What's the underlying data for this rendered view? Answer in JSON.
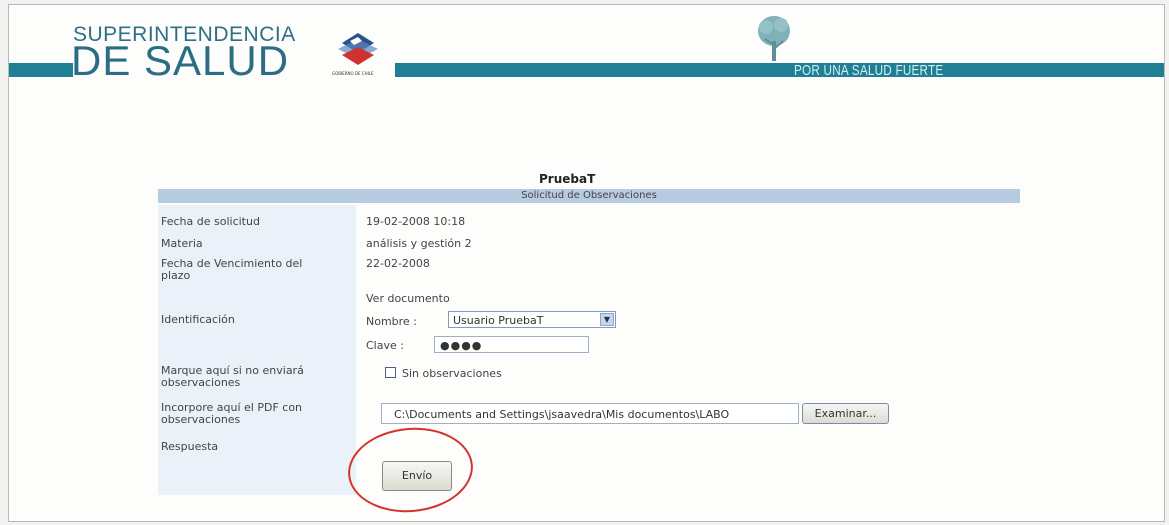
{
  "header": {
    "logo_line1": "SUPERINTENDENCIA",
    "logo_line2": "DE SALUD",
    "logo_small_text": "GOBIERNO DE CHILE",
    "slogan": "POR UNA SALUD FUERTE",
    "band_color": "#1e7f95"
  },
  "form": {
    "title": "PruebaT",
    "subtitle": "Solicitud de Observaciones",
    "labels": {
      "fecha_solicitud": "Fecha de solicitud",
      "materia": "Materia",
      "fecha_vencimiento_1": "Fecha de Vencimiento del",
      "fecha_vencimiento_2": "plazo",
      "identificacion": "Identificación",
      "sin_obs_1": "Marque aquí si no enviará",
      "sin_obs_2": "observaciones",
      "pdf_1": "Incorpore aquí el PDF con",
      "pdf_2": "observaciones",
      "respuesta": "Respuesta"
    },
    "values": {
      "fecha_solicitud": "19-02-2008 10:18",
      "materia": "análisis y gestión 2",
      "fecha_vencimiento": "22-02-2008",
      "ver_documento": "Ver documento",
      "nombre_label": "Nombre :",
      "nombre_selected": "Usuario PruebaT",
      "clave_label": "Clave :",
      "clave_masked": "●●●●",
      "checkbox_label": "Sin observaciones",
      "file_path": "C:\\Documents and Settings\\jsaavedra\\Mis documentos\\LABO",
      "browse_button": "Examinar...",
      "send_button": "Envío"
    },
    "colors": {
      "subheader_bg": "#b6cbe0",
      "label_col_bg": "#eaf1f8",
      "highlight_circle": "#d5332e"
    }
  }
}
